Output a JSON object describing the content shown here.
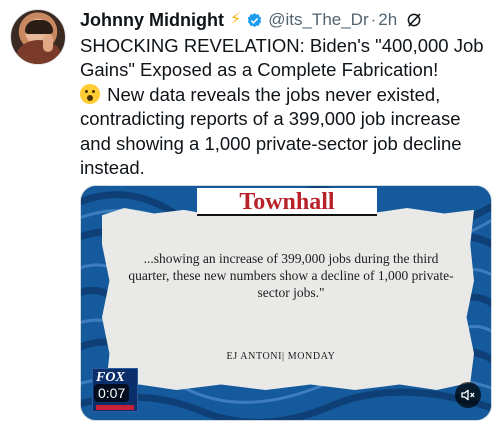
{
  "author": {
    "name": "Johnny Midnight",
    "handle": "@its_The_Dr",
    "separator": "·",
    "time": "2h"
  },
  "tweet": {
    "headline": "SHOCKING REVELATION: Biden's \"400,000 Job Gains\" Exposed as a Complete Fabrication!",
    "body": "New data reveals the jobs never existed, contradicting reports of a 399,000 job increase and showing a 1,000 private-sector job decline instead."
  },
  "media": {
    "source_logo": "Townhall",
    "quote": "...showing an increase of 399,000 jobs during the third quarter, these new numbers show a decline of 1,000 private-sector jobs.\"",
    "byline": "EJ ANTONI| MONDAY",
    "network_logo": "FOX",
    "timer": "0:07"
  },
  "icons": {
    "bolt": "lightning-bolt-icon",
    "verified": "verified-badge-icon",
    "grok": "grok-icon",
    "emoji": "astonished-face-emoji",
    "mute": "muted-speaker-icon"
  },
  "colors": {
    "verified": "#1d9bf0",
    "handle": "#536471",
    "townhall": "#b8222a",
    "bolt": "#f5b50a"
  }
}
